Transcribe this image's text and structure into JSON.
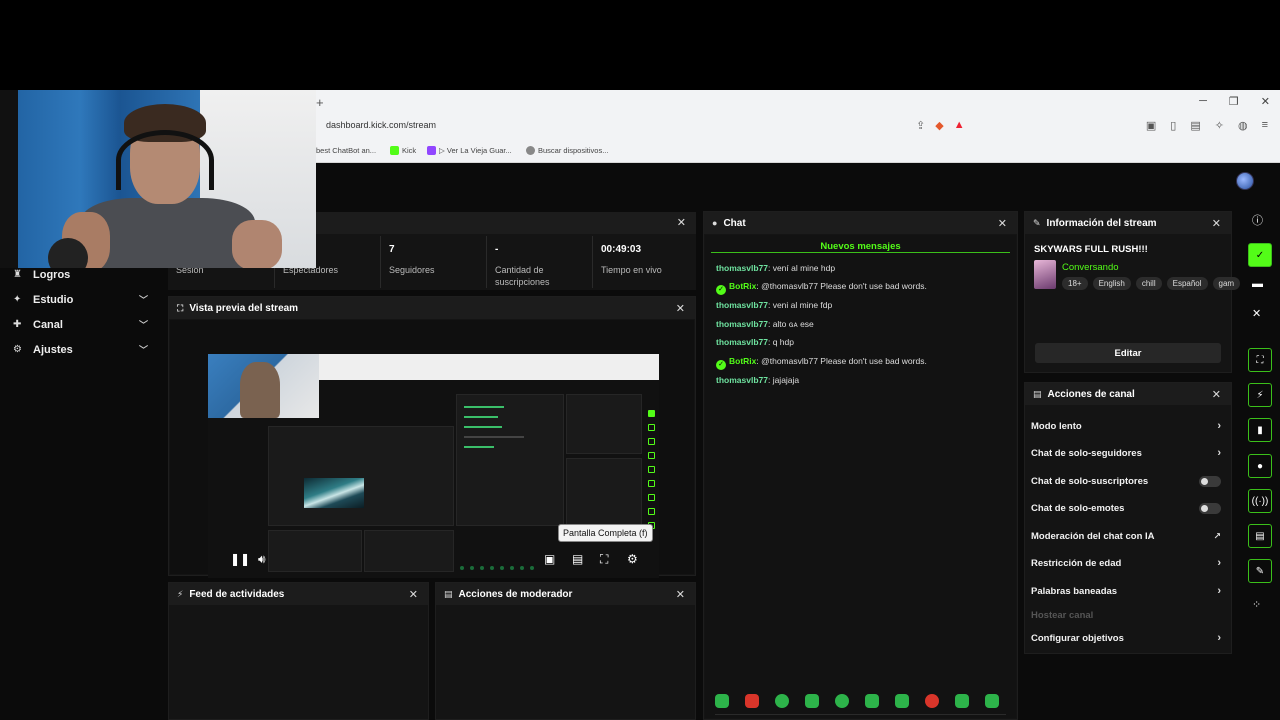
{
  "browser": {
    "new_tab": "+",
    "url": "dashboard.kick.com/stream",
    "window_controls": [
      "─",
      "❐",
      "✕"
    ],
    "bookmarks": [
      {
        "label": "best ChatBot an..."
      },
      {
        "label": "Kick"
      },
      {
        "label": "▷ Ver La Vieja Guar..."
      },
      {
        "label": "Buscar dispositivos..."
      }
    ]
  },
  "sidebar": {
    "items": [
      {
        "label": "Logros",
        "icon": "trophy-icon",
        "glyph": "♜"
      },
      {
        "label": "Estudio",
        "icon": "studio-icon",
        "glyph": "✦"
      },
      {
        "label": "Canal",
        "icon": "channel-icon",
        "glyph": "✚"
      },
      {
        "label": "Ajustes",
        "icon": "settings-icon",
        "glyph": "⚙"
      }
    ]
  },
  "stats": {
    "items": [
      {
        "value": "",
        "label": "Sesión"
      },
      {
        "value": "",
        "label": "Espectadores"
      },
      {
        "value": "7",
        "label": "Seguidores"
      },
      {
        "value": "-",
        "label": "Cantidad de suscripciones"
      },
      {
        "value": "00:49:03",
        "label": "Tiempo en vivo"
      }
    ]
  },
  "preview": {
    "title": "Vista previa del stream",
    "tooltip": "Pantalla Completa (f)"
  },
  "feed": {
    "title": "Feed de actividades"
  },
  "mod_actions": {
    "title": "Acciones de moderador"
  },
  "chat": {
    "title": "Chat",
    "new_messages": "Nuevos mensajes",
    "messages": [
      {
        "user": "thomasvlb77",
        "text": ": vení al mine hdp",
        "bot": false
      },
      {
        "user": "BotRix",
        "text": ": @thomasvlb77 Please don't use bad words.",
        "bot": true
      },
      {
        "user": "thomasvlb77",
        "text": ": veni al mine fdp",
        "bot": false
      },
      {
        "user": "thomasvlb77",
        "text": ": alto ɢᴀ ese",
        "bot": false
      },
      {
        "user": "thomasvlb77",
        "text": ": q hdp",
        "bot": false
      },
      {
        "user": "BotRix",
        "text": ": @thomasvlb77 Please don't use bad words.",
        "bot": true
      },
      {
        "user": "thomasvlb77",
        "text": ": jajajaja",
        "bot": false
      }
    ]
  },
  "stream_info": {
    "header": "Información del stream",
    "title": "SKYWARS FULL RUSH!!!",
    "category": "Conversando",
    "tags": [
      "18+",
      "English",
      "chill",
      "Español",
      "gam"
    ],
    "edit_label": "Editar"
  },
  "channel_actions": {
    "header": "Acciones de canal",
    "items": [
      {
        "label": "Modo lento",
        "control": "chevron"
      },
      {
        "label": "Chat de solo-seguidores",
        "control": "chevron"
      },
      {
        "label": "Chat de solo-suscriptores",
        "control": "toggle"
      },
      {
        "label": "Chat de solo-emotes",
        "control": "toggle"
      },
      {
        "label": "Moderación del chat con IA",
        "control": "chart"
      },
      {
        "label": "Restricción de edad",
        "control": "chevron"
      },
      {
        "label": "Palabras baneadas",
        "control": "chevron"
      },
      {
        "label": "Hostear canal",
        "control": "none"
      },
      {
        "label": "Configurar objetivos",
        "control": "chevron"
      }
    ]
  },
  "colors": {
    "accent": "#53fc18",
    "background": "#0b0b0b",
    "panel": "#141414"
  }
}
